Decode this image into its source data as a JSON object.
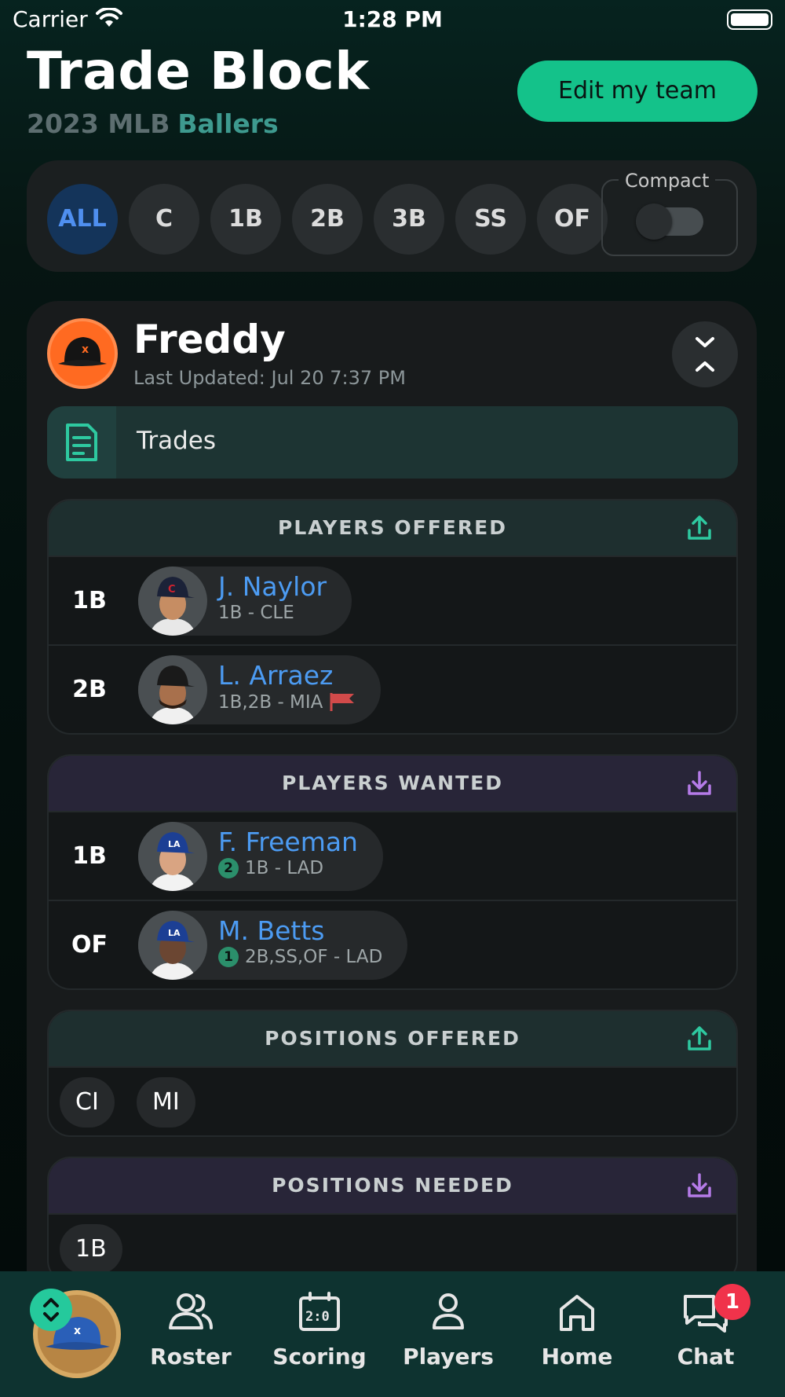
{
  "status_bar": {
    "carrier": "Carrier",
    "time": "1:28 PM"
  },
  "header": {
    "title": "Trade Block",
    "season": "2023 MLB",
    "league": "Ballers",
    "edit_button_label": "Edit my team"
  },
  "filter": {
    "positions": [
      "ALL",
      "C",
      "1B",
      "2B",
      "3B",
      "SS",
      "OF"
    ],
    "active": "ALL",
    "compact_label": "Compact",
    "compact_on": false
  },
  "team": {
    "name": "Freddy",
    "last_updated": "Last Updated: Jul 20 7:37 PM",
    "trades_label": "Trades",
    "players_offered": {
      "title": "PLAYERS OFFERED",
      "rows": [
        {
          "pos": "1B",
          "name": "J. Naylor",
          "meta": "1B - CLE"
        },
        {
          "pos": "2B",
          "name": "L. Arraez",
          "meta": "1B,2B - MIA"
        }
      ]
    },
    "players_wanted": {
      "title": "PLAYERS WANTED",
      "rows": [
        {
          "pos": "1B",
          "name": "F. Freeman",
          "rank": "2",
          "meta": "1B - LAD"
        },
        {
          "pos": "OF",
          "name": "M. Betts",
          "rank": "1",
          "meta": "2B,SS,OF - LAD"
        }
      ]
    },
    "positions_offered": {
      "title": "POSITIONS OFFERED",
      "tags": [
        "CI",
        "MI"
      ]
    },
    "positions_needed": {
      "title": "POSITIONS NEEDED",
      "tags": [
        "1B"
      ]
    }
  },
  "nav": {
    "items": [
      {
        "label": "Roster",
        "icon": "users-icon"
      },
      {
        "label": "Scoring",
        "icon": "scoreboard-icon"
      },
      {
        "label": "Players",
        "icon": "person-icon"
      },
      {
        "label": "Home",
        "icon": "home-icon"
      },
      {
        "label": "Chat",
        "icon": "chat-icon"
      }
    ],
    "chat_badge": "1"
  },
  "colors": {
    "accent": "#14c28a",
    "link": "#4c9bf2",
    "offered_header": "#1e2f2f",
    "wanted_header": "#282538",
    "badge": "#f0334b"
  }
}
